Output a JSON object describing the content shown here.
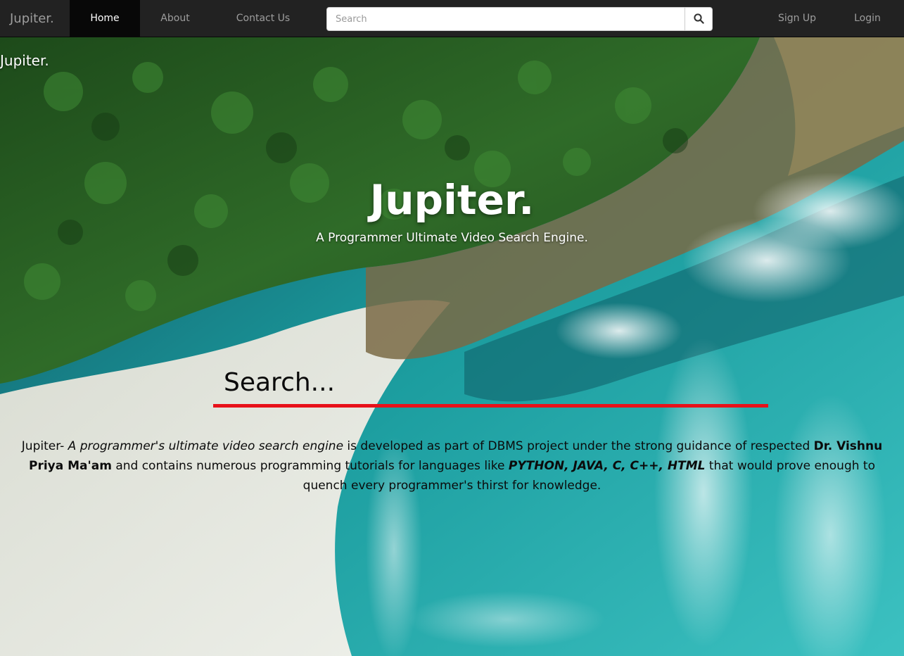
{
  "navbar": {
    "brand": "Jupiter.",
    "links": [
      "Home",
      "About",
      "Contact Us"
    ],
    "active": "Home",
    "search_placeholder": "Search",
    "right_links": [
      "Sign Up",
      "Login"
    ]
  },
  "hero": {
    "corner_logo": "Jupiter.",
    "title": "Jupiter.",
    "subtitle": "A Programmer Ultimate Video Search Engine."
  },
  "main_search": {
    "placeholder": "Search..."
  },
  "about": {
    "part1": "Jupiter- ",
    "part2_italic": "A programmer's ultimate video search engine",
    "part3": " is developed as part of DBMS project under the strong guidance of respected ",
    "part4_bold": "Dr. Vishnu Priya Ma'am",
    "part5": " and contains numerous programming tutorials for languages like ",
    "part6_bold_italic": "PYTHON, JAVA, C, C++, HTML",
    "part7": " that would prove enough to quench every programmer's thirst for knowledge."
  },
  "icons": {
    "search_button": "search-icon"
  },
  "colors": {
    "navbar_bg": "#222222",
    "nav_active_bg": "#080808",
    "search_underline": "#e8111a"
  }
}
